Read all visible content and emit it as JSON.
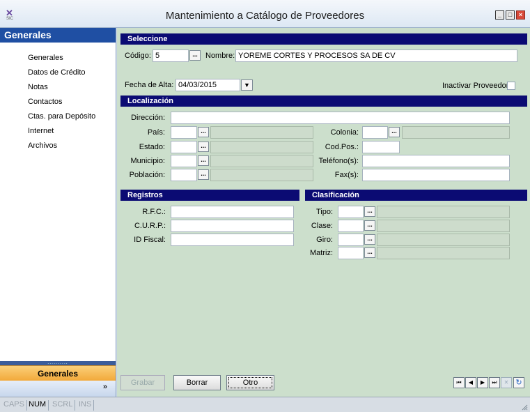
{
  "window": {
    "title": "Mantenimiento a Catálogo de Proveedores",
    "logo_text": "SIC",
    "min": "_",
    "max": "□",
    "close": "×"
  },
  "sidebar": {
    "header": "Generales",
    "items": [
      {
        "label": "Generales"
      },
      {
        "label": "Datos de Crédito"
      },
      {
        "label": "Notas"
      },
      {
        "label": "Contactos"
      },
      {
        "label": "Ctas. para Depósito"
      },
      {
        "label": "Internet"
      },
      {
        "label": "Archivos"
      }
    ],
    "grip_dots": "..........",
    "bottom_tab": "Generales",
    "chevron": "»"
  },
  "seleccion": {
    "header": "Seleccione",
    "codigo_label": "Código:",
    "codigo_value": "5",
    "nombre_label": "Nombre:",
    "nombre_value": "YOREME CORTES Y PROCESOS SA DE CV",
    "fecha_label": "Fecha de Alta:",
    "fecha_value": "04/03/2015",
    "inactivar_label": "Inactivar Proveedor:"
  },
  "localizacion": {
    "header": "Localización",
    "direccion_label": "Dirección:",
    "pais_label": "País:",
    "estado_label": "Estado:",
    "municipio_label": "Municipio:",
    "poblacion_label": "Población:",
    "colonia_label": "Colonia:",
    "codpos_label": "Cod.Pos.:",
    "telefono_label": "Teléfono(s):",
    "fax_label": "Fax(s):"
  },
  "registros": {
    "header": "Registros",
    "rfc_label": "R.F.C.:",
    "curp_label": "C.U.R.P.:",
    "idfiscal_label": "ID Fiscal:"
  },
  "clasificacion": {
    "header": "Clasificación",
    "tipo_label": "Tipo:",
    "clase_label": "Clase:",
    "giro_label": "Giro:",
    "matriz_label": "Matriz:"
  },
  "actions": {
    "grabar": "Grabar",
    "borrar": "Borrar",
    "otro": "Otro"
  },
  "lookup_glyph": "...",
  "dropdown_glyph": "▼",
  "nav": {
    "first": "⏮",
    "prev": "◀",
    "next": "▶",
    "last": "⏭",
    "cancel": "✕",
    "refresh": "↻"
  },
  "statusbar": {
    "caps": "CAPS",
    "num": "NUM",
    "scrl": "SCRL",
    "ins": "INS"
  },
  "colors": {
    "section_header": "#0b0b73",
    "form_bg": "#ccdfcc",
    "sidebar_header": "#1f4fa3",
    "bottom_tab": "#f2a93a"
  }
}
